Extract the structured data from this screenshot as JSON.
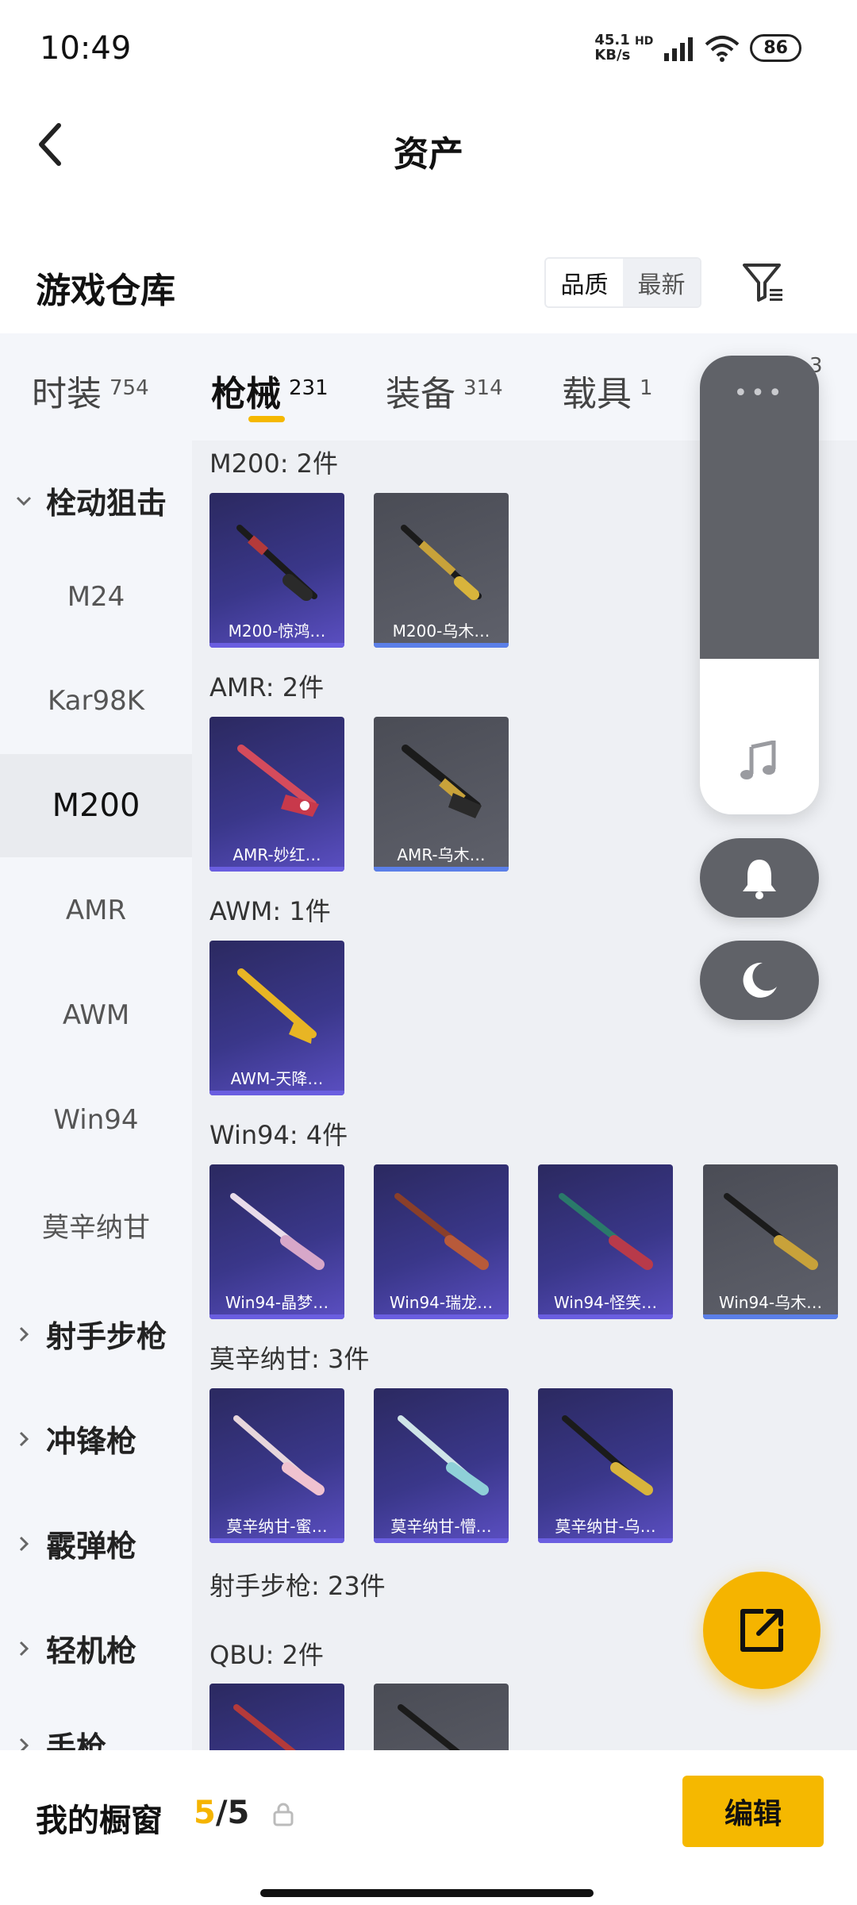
{
  "status": {
    "time": "10:49",
    "net_speed": "45.1",
    "net_unit": "KB/s",
    "hd": "HD",
    "battery": "86"
  },
  "header": {
    "title": "资产",
    "back_icon": "chevron-left-icon"
  },
  "warehouse": {
    "title": "游戏仓库",
    "sort_options": [
      "品质",
      "最新"
    ],
    "sort_selected": "品质",
    "filter_icon": "filter-icon"
  },
  "category_tabs": [
    {
      "label": "时装",
      "count": "754"
    },
    {
      "label": "枪械",
      "count": "231"
    },
    {
      "label": "装备",
      "count": "314"
    },
    {
      "label": "载具",
      "count": "1"
    },
    {
      "label": "",
      "count": "3"
    }
  ],
  "category_selected": "枪械",
  "sidebar": {
    "group_open": "栓动狙击",
    "subitems": [
      "M24",
      "Kar98K",
      "M200",
      "AMR",
      "AWM",
      "Win94",
      "莫辛纳甘"
    ],
    "selected": "M200",
    "groups": [
      "射手步枪",
      "冲锋枪",
      "霰弹枪",
      "轻机枪",
      "手枪"
    ]
  },
  "sections": [
    {
      "title": "M200: 2件",
      "items": [
        {
          "label": "M200-惊鸿…",
          "rarity": "purple"
        },
        {
          "label": "M200-乌木…",
          "rarity": "gray"
        }
      ]
    },
    {
      "title": "AMR: 2件",
      "items": [
        {
          "label": "AMR-妙红…",
          "rarity": "purple"
        },
        {
          "label": "AMR-乌木…",
          "rarity": "gray"
        }
      ]
    },
    {
      "title": "AWM: 1件",
      "items": [
        {
          "label": "AWM-天降…",
          "rarity": "purple"
        }
      ]
    },
    {
      "title": "Win94: 4件",
      "items": [
        {
          "label": "Win94-晶梦…",
          "rarity": "purple"
        },
        {
          "label": "Win94-瑞龙…",
          "rarity": "purple"
        },
        {
          "label": "Win94-怪笑…",
          "rarity": "purple"
        },
        {
          "label": "Win94-乌木…",
          "rarity": "gray"
        }
      ]
    },
    {
      "title": "莫辛纳甘: 3件",
      "items": [
        {
          "label": "莫辛纳甘-蜜…",
          "rarity": "purple"
        },
        {
          "label": "莫辛纳甘-懵…",
          "rarity": "purple"
        },
        {
          "label": "莫辛纳甘-乌…",
          "rarity": "purple"
        }
      ]
    },
    {
      "title": "射手步枪: 23件",
      "items": []
    },
    {
      "title": "QBU: 2件",
      "items": [
        {
          "label": "",
          "rarity": "purple"
        },
        {
          "label": "",
          "rarity": "gray"
        }
      ]
    }
  ],
  "floating_panel": {
    "dots": "•••",
    "icons": [
      "music-note-icon",
      "bell-icon",
      "moon-icon"
    ]
  },
  "bottom": {
    "showcase_label": "我的橱窗",
    "showcase_current": "5",
    "showcase_total": "/5",
    "edit_label": "编辑"
  },
  "colors": {
    "accent": "#f5b800",
    "purple_card": "#3a378a",
    "gray_card": "#5f616b"
  }
}
